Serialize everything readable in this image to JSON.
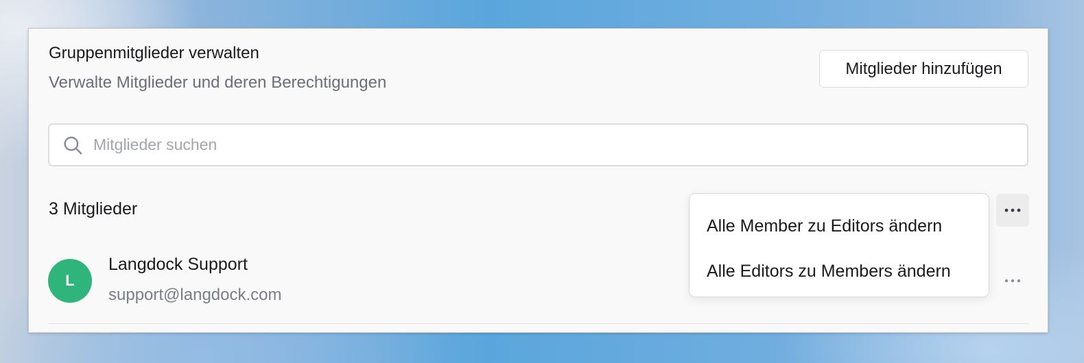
{
  "header": {
    "title": "Gruppenmitglieder verwalten",
    "subtitle": "Verwalte Mitglieder und deren Berechtigungen",
    "add_button_label": "Mitglieder hinzufügen"
  },
  "search": {
    "placeholder": "Mitglieder suchen",
    "value": "",
    "icon": "search-icon"
  },
  "members_section": {
    "count_label": "3 Mitglieder",
    "more_icon": "more-horizontal-icon"
  },
  "members": [
    {
      "initial": "L",
      "name": "Langdock Support",
      "email": "support@langdock.com",
      "avatar_color": "#2fb57b"
    }
  ],
  "bulk_menu": {
    "items": [
      {
        "label": "Alle Member zu Editors ändern"
      },
      {
        "label": "Alle Editors zu Members ändern"
      }
    ]
  }
}
